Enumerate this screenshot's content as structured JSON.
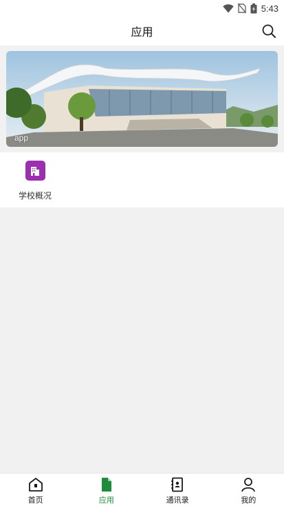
{
  "status_bar": {
    "time": "5:43",
    "icons": [
      "wifi-icon",
      "no-sim-icon",
      "battery-icon"
    ]
  },
  "header": {
    "title": "应用",
    "search_icon": "search-icon"
  },
  "banner": {
    "caption": "app",
    "image": "campus-building-photo"
  },
  "apps": [
    {
      "label": "学校概况",
      "icon": "school-building-icon",
      "color": "#9c2fb0"
    }
  ],
  "bottom_nav": {
    "active_color": "#1e8c3a",
    "inactive_color": "#1a1a1a",
    "items": [
      {
        "label": "首页",
        "icon": "home-icon",
        "active": false
      },
      {
        "label": "应用",
        "icon": "document-icon",
        "active": true
      },
      {
        "label": "通讯录",
        "icon": "contacts-book-icon",
        "active": false
      },
      {
        "label": "我的",
        "icon": "person-icon",
        "active": false
      }
    ]
  }
}
